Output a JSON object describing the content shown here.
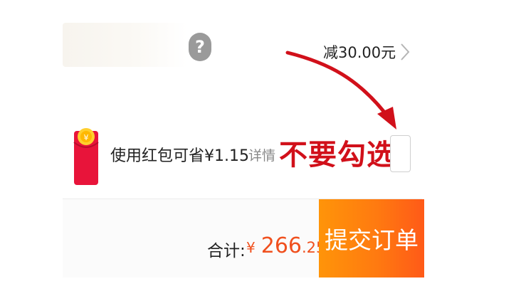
{
  "coupon_row": {
    "help_icon_glyph": "?",
    "discount_text": "减30.00元"
  },
  "red_packet_row": {
    "label": "使用红包可省¥1.15",
    "details_link": "详情",
    "annotation": "不要勾选",
    "checkbox_checked": false
  },
  "footer": {
    "total_label": "合计:",
    "currency": "¥",
    "amount_int": "266",
    "amount_dec": ".25",
    "submit_label": "提交订单"
  },
  "colors": {
    "accent_orange": "#ff7a10",
    "price_orange": "#f0501e",
    "annotation_red": "#d1101a"
  },
  "icons": {
    "help": "question-circle-icon",
    "chevron": "chevron-right-icon",
    "red_packet": "hongbao-icon",
    "annotation_arrow": "red-arrow-icon"
  }
}
